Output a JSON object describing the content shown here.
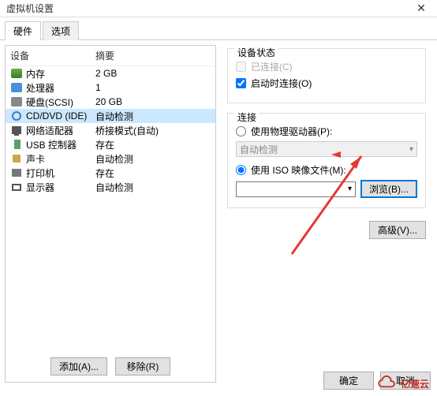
{
  "title": "虚拟机设置",
  "close_glyph": "✕",
  "tabs": {
    "hardware": "硬件",
    "options": "选项"
  },
  "list_header": {
    "device": "设备",
    "summary": "摘要"
  },
  "devices": [
    {
      "name": "内存",
      "summary": "2 GB",
      "icon": "memory-icon"
    },
    {
      "name": "处理器",
      "summary": "1",
      "icon": "cpu-icon"
    },
    {
      "name": "硬盘(SCSI)",
      "summary": "20 GB",
      "icon": "hdd-icon"
    },
    {
      "name": "CD/DVD (IDE)",
      "summary": "自动检测",
      "icon": "cd-icon"
    },
    {
      "name": "网络适配器",
      "summary": "桥接模式(自动)",
      "icon": "network-icon"
    },
    {
      "name": "USB 控制器",
      "summary": "存在",
      "icon": "usb-icon"
    },
    {
      "name": "声卡",
      "summary": "自动检测",
      "icon": "sound-icon"
    },
    {
      "name": "打印机",
      "summary": "存在",
      "icon": "printer-icon"
    },
    {
      "name": "显示器",
      "summary": "自动检测",
      "icon": "display-icon"
    }
  ],
  "left_buttons": {
    "add": "添加(A)...",
    "remove": "移除(R)"
  },
  "status": {
    "title": "设备状态",
    "connected": "已连接(C)",
    "connect_at_power_on": "启动时连接(O)"
  },
  "connection": {
    "title": "连接",
    "use_physical": "使用物理驱动器(P):",
    "physical_value": "自动检测",
    "use_iso": "使用 ISO 映像文件(M):",
    "iso_value": "",
    "browse": "浏览(B)..."
  },
  "advanced": "高级(V)...",
  "footer": {
    "ok": "确定",
    "cancel": "取消"
  },
  "watermark": "亿速云"
}
